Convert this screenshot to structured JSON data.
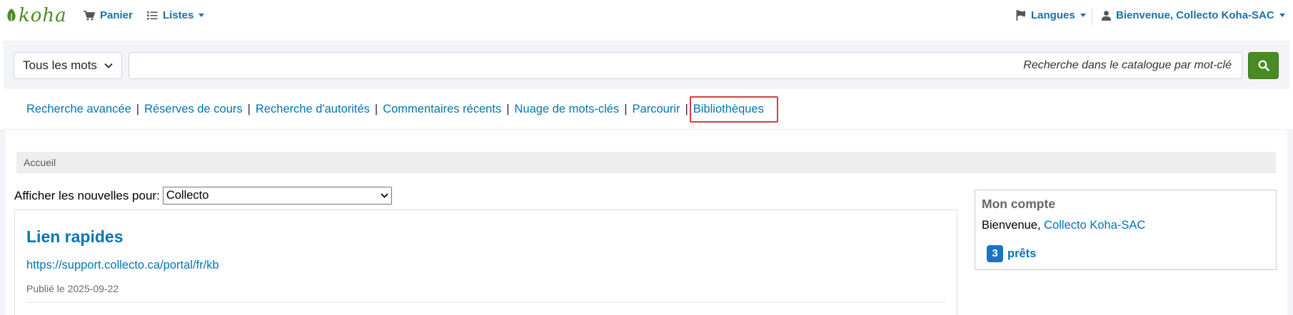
{
  "navbar": {
    "logo_text": "koha",
    "cart_label": "Panier",
    "lists_label": "Listes",
    "languages_label": "Langues",
    "user_label": "Bienvenue, Collecto Koha-SAC"
  },
  "search": {
    "type_selected": "Tous les mots",
    "placeholder": "Recherche dans le catalogue par mot-clé",
    "accent_color": "#4a8a24"
  },
  "more_searches": [
    "Recherche avancée",
    "Réserves de cours",
    "Recherche d'autorités",
    "Commentaires récents",
    "Nuage de mots-clés",
    "Parcourir",
    "Bibliothèques"
  ],
  "breadcrumb": {
    "home": "Accueil"
  },
  "news": {
    "filter_label": "Afficher les nouvelles pour:",
    "filter_selected": "Collecto",
    "title": "Lien rapides",
    "link": "https://support.collecto.ca/portal/fr/kb",
    "published": "Publié le 2025-09-22"
  },
  "account": {
    "title": "Mon compte",
    "welcome_prefix": "Bienvenue,",
    "user_name": "Collecto Koha-SAC",
    "loans_count": "3",
    "loans_label": "prêts"
  },
  "icons": {
    "cart": "cart-icon",
    "lists": "list-icon",
    "flag": "flag-icon",
    "user": "user-icon",
    "search": "search-icon"
  }
}
